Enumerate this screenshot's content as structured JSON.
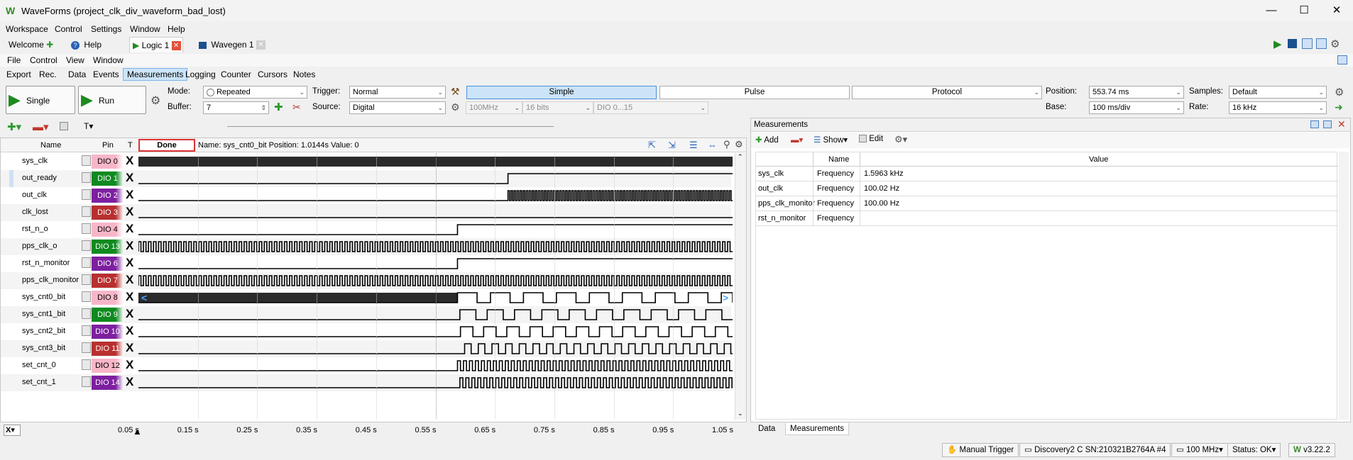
{
  "title": "WaveForms (project_clk_div_waveform_bad_lost)",
  "menu": [
    "Workspace",
    "Control",
    "Settings",
    "Window",
    "Help"
  ],
  "doc_tabs": [
    {
      "label": "Welcome"
    },
    {
      "label": "Help"
    },
    {
      "label": "Logic 1"
    },
    {
      "label": "Wavegen 1"
    }
  ],
  "submenu": [
    "File",
    "Control",
    "View",
    "Window"
  ],
  "tool_tabs": [
    "Export",
    "Rec.",
    "Data",
    "Events",
    "Measurements",
    "Logging",
    "Counter",
    "Cursors",
    "Notes"
  ],
  "toolbar": {
    "single": "Single",
    "run": "Run",
    "mode_label": "Mode:",
    "mode": "Repeated",
    "buffer_label": "Buffer:",
    "buffer": "7",
    "trigger_label": "Trigger:",
    "trigger": "Normal",
    "source_label": "Source:",
    "source": "Digital",
    "rate1": "100MHz",
    "bits": "16 bits",
    "dio": "DIO 0...15",
    "simple": "Simple",
    "pulse": "Pulse",
    "protocol": "Protocol",
    "position_label": "Position:",
    "position": "553.74 ms",
    "base_label": "Base:",
    "base": "100 ms/div",
    "samples_label": "Samples:",
    "samples": "Default",
    "rate_label": "Rate:",
    "rate": "16 kHz"
  },
  "list": {
    "hdr_name": "Name",
    "hdr_pin": "Pin",
    "hdr_t": "T",
    "done": "Done",
    "info": "Name: sys_cnt0_bit  Position: 1.0144s  Value: 0"
  },
  "channels": [
    {
      "name": "sys_clk",
      "pin": "DIO 0",
      "color": "#f7b6c8",
      "text": "#000"
    },
    {
      "name": "out_ready",
      "pin": "DIO 1",
      "color": "#0f8a1f",
      "text": "#fff"
    },
    {
      "name": "out_clk",
      "pin": "DIO 2",
      "color": "#7d1fa0",
      "text": "#fff"
    },
    {
      "name": "clk_lost",
      "pin": "DIO 3",
      "color": "#b82f2f",
      "text": "#fff"
    },
    {
      "name": "rst_n_o",
      "pin": "DIO 4",
      "color": "#f7b6c8",
      "text": "#000"
    },
    {
      "name": "pps_clk_o",
      "pin": "DIO 13",
      "color": "#0f8a1f",
      "text": "#fff"
    },
    {
      "name": "rst_n_monitor",
      "pin": "DIO 6",
      "color": "#7d1fa0",
      "text": "#fff"
    },
    {
      "name": "pps_clk_monitor",
      "pin": "DIO 7",
      "color": "#b82f2f",
      "text": "#fff"
    },
    {
      "name": "sys_cnt0_bit",
      "pin": "DIO 8",
      "color": "#f7b6c8",
      "text": "#000"
    },
    {
      "name": "sys_cnt1_bit",
      "pin": "DIO 9",
      "color": "#0f8a1f",
      "text": "#fff"
    },
    {
      "name": "sys_cnt2_bit",
      "pin": "DIO 10",
      "color": "#7d1fa0",
      "text": "#fff"
    },
    {
      "name": "sys_cnt3_bit",
      "pin": "DIO 11",
      "color": "#b82f2f",
      "text": "#fff"
    },
    {
      "name": "set_cnt_0",
      "pin": "DIO 12",
      "color": "#f7b6c8",
      "text": "#000"
    },
    {
      "name": "set_cnt_1",
      "pin": "DIO 14",
      "color": "#7d1fa0",
      "text": "#fff"
    }
  ],
  "x_ticks": [
    "0.05 s",
    "0.15 s",
    "0.25 s",
    "0.35 s",
    "0.45 s",
    "0.55 s",
    "0.65 s",
    "0.75 s",
    "0.85 s",
    "0.95 s",
    "1.05 s"
  ],
  "measurements": {
    "title": "Measurements",
    "add": "Add",
    "show": "Show",
    "edit": "Edit",
    "col_name": "Name",
    "col_value": "Value",
    "rows": [
      {
        "ch": "sys_clk",
        "type": "Frequency",
        "value": "1.5963 kHz"
      },
      {
        "ch": "out_clk",
        "type": "Frequency",
        "value": "100.02 Hz"
      },
      {
        "ch": "pps_clk_monitor",
        "type": "Frequency",
        "value": "100.00 Hz"
      },
      {
        "ch": "rst_n_monitor",
        "type": "Frequency",
        "value": ""
      }
    ],
    "tabs": [
      "Data",
      "Measurements"
    ]
  },
  "status": {
    "trigger": "Manual Trigger",
    "device": "Discovery2 C SN:210321B2764A #4",
    "clock": "100 MHz",
    "state": "Status: OK",
    "version": "v3.22.2"
  },
  "xbox": "X"
}
